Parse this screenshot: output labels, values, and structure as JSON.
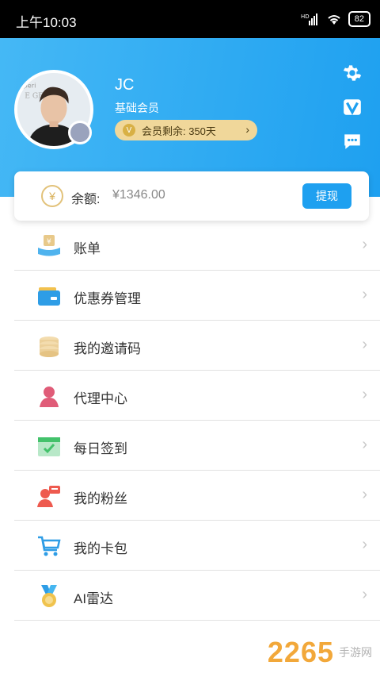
{
  "status_bar": {
    "time": "上午10:03",
    "battery": "82",
    "icons": [
      "hd-icon",
      "signal-icon",
      "wifi-icon",
      "battery-icon"
    ]
  },
  "profile": {
    "username": "JC",
    "level": "基础会员",
    "membership_remaining": "会员剩余: 350天",
    "avatar_badge_icon": "badge-icon",
    "membership_chevron": "chevron-right-icon"
  },
  "side_actions": [
    {
      "name": "settings-icon"
    },
    {
      "name": "vip-icon"
    },
    {
      "name": "message-icon"
    }
  ],
  "balance": {
    "label": "余额:",
    "amount": "¥1346.00",
    "withdraw_label": "提现",
    "icon": "yen-icon"
  },
  "menu": [
    {
      "label": "账单",
      "icon": "bill-icon"
    },
    {
      "label": "优惠券管理",
      "icon": "coupon-icon"
    },
    {
      "label": "我的邀请码",
      "icon": "invite-icon"
    },
    {
      "label": "代理中心",
      "icon": "agent-icon"
    },
    {
      "label": "每日签到",
      "icon": "calendar-icon"
    },
    {
      "label": "我的粉丝",
      "icon": "fans-icon"
    },
    {
      "label": "我的卡包",
      "icon": "cart-icon"
    },
    {
      "label": "AI雷达",
      "icon": "medal-icon"
    }
  ],
  "watermark": {
    "number": "2265",
    "site": "手游网"
  },
  "colors": {
    "accent": "#1ea0f0",
    "header_gradient_start": "#45b8f5",
    "member_pill": "#f0d79a",
    "status_bar": "#000000"
  }
}
